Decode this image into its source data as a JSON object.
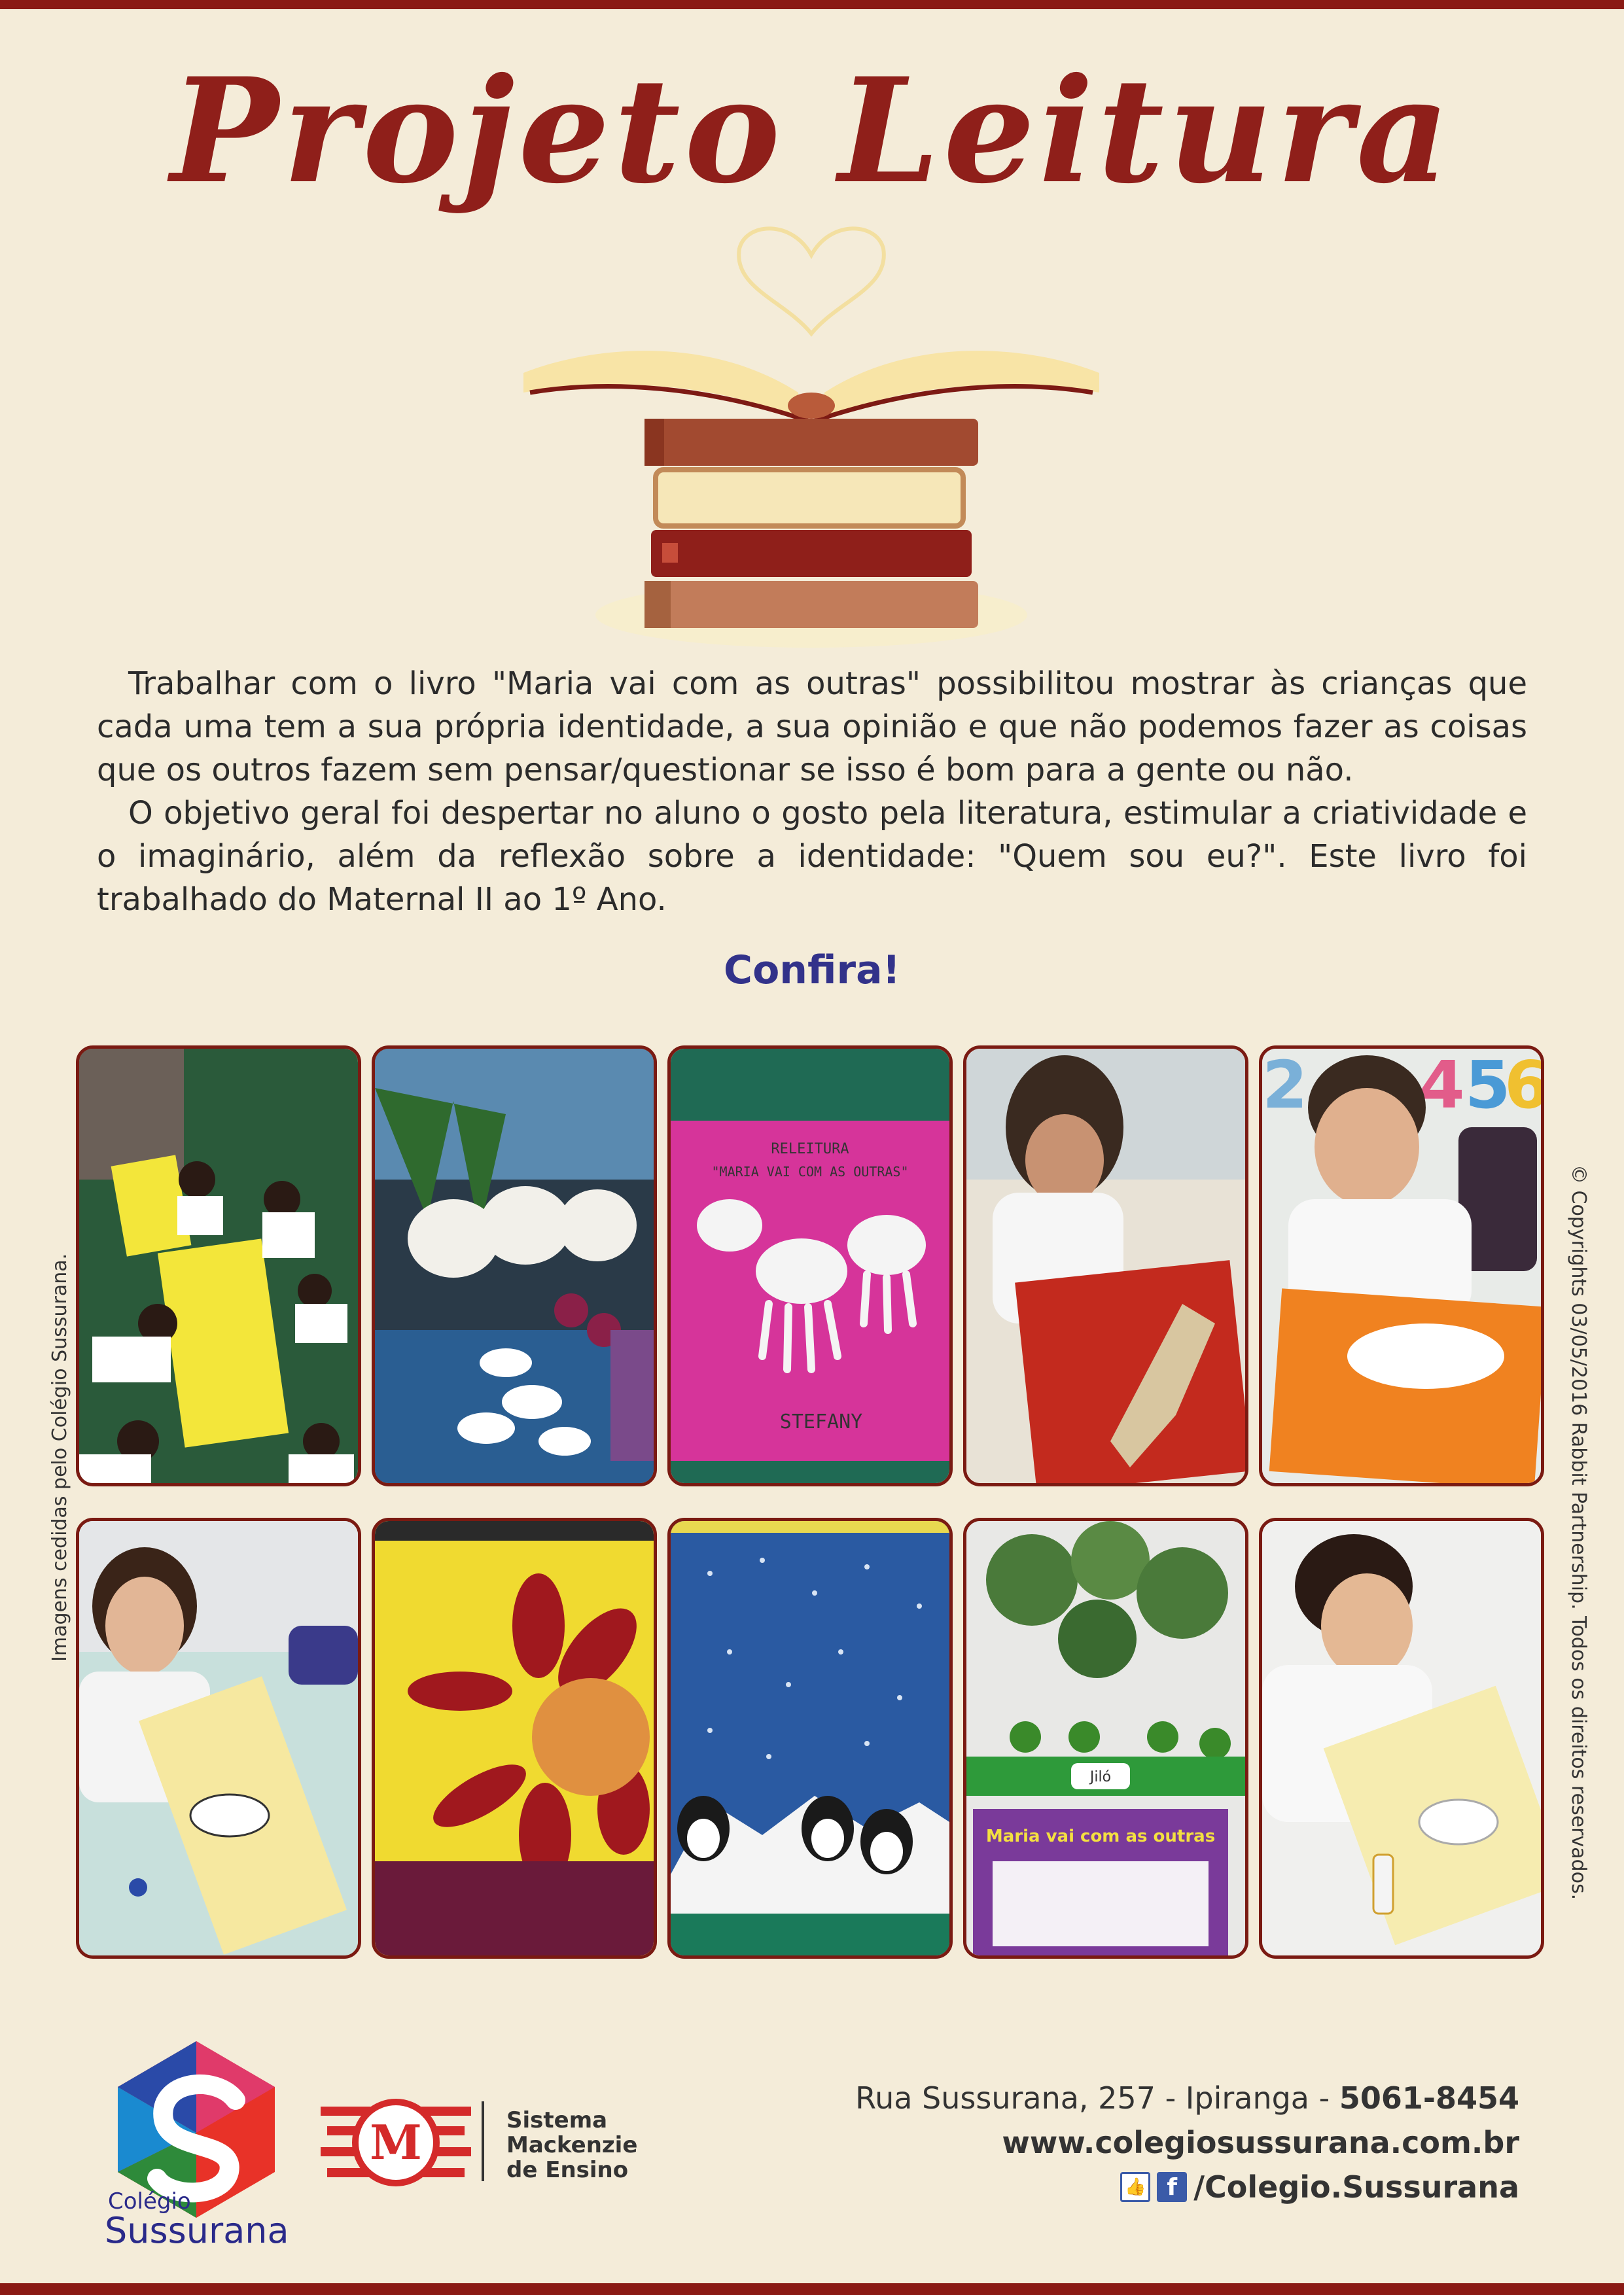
{
  "title": "Projeto Leitura",
  "body": {
    "paragraph1": "Trabalhar com o livro \"Maria vai com as outras\" possibilitou mostrar às crianças que cada uma tem a sua própria identidade, a sua opinião e que não podemos fazer as coisas que os outros fazem sem pensar/questionar se isso é bom para a gente ou não.",
    "paragraph2": "O objetivo geral foi despertar no aluno o gosto pela literatura, estimular a criatividade e o imaginário, além da reflexão sobre a identidade: \"Quem sou eu?\". Este livro foi trabalhado do Maternal II ao 1º Ano."
  },
  "confira": "Confira!",
  "photos": {
    "p3_line1": "RELEITURA",
    "p3_line2": "\"MARIA VAI COM AS OUTRAS\"",
    "p3_name": "STEFANY",
    "p9_sign": "Jiló",
    "p9_book": "Maria vai com as outras"
  },
  "side_left": "Imagens cedidas pelo Colégio Sussurana.",
  "side_right": "© Copyrights 03/05/2016 Rabbit Partnership. Todos os direitos reservados.",
  "logo": {
    "small": "Colégio",
    "big": "Sussurana"
  },
  "mackenzie": {
    "line1": "Sistema",
    "line2": "Mackenzie",
    "line3": "de Ensino"
  },
  "contact": {
    "address": "Rua Sussurana, 257 - Ipiranga - ",
    "phone": "5061-8454",
    "website": "www.colegiosussurana.com.br",
    "facebook": "/Colegio.Sussurana"
  },
  "colors": {
    "accent": "#8f1f1a",
    "confira": "#32328a",
    "background": "#f4ecd9"
  },
  "icons": [
    "open-book-heart-icon",
    "book-stack-icon",
    "like-icon",
    "facebook-icon",
    "sussurana-logo",
    "mackenzie-logo"
  ]
}
